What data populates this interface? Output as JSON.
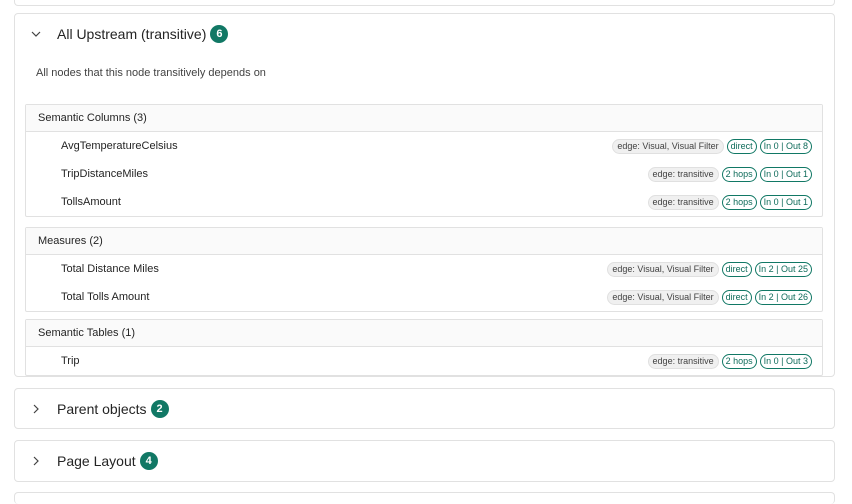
{
  "upstream": {
    "title": "All Upstream (transitive)",
    "count": "6",
    "description": "All nodes that this node transitively depends on",
    "groups": [
      {
        "label": "Semantic Columns (3)",
        "items": [
          {
            "name": "AvgTemperatureCelsius",
            "edge": "edge: Visual, Visual Filter",
            "distance": "direct",
            "io": "In 0 | Out 8"
          },
          {
            "name": "TripDistanceMiles",
            "edge": "edge: transitive",
            "distance": "2 hops",
            "io": "In 0 | Out 1"
          },
          {
            "name": "TollsAmount",
            "edge": "edge: transitive",
            "distance": "2 hops",
            "io": "In 0 | Out 1"
          }
        ]
      },
      {
        "label": "Measures (2)",
        "items": [
          {
            "name": "Total Distance Miles",
            "edge": "edge: Visual, Visual Filter",
            "distance": "direct",
            "io": "In 2 | Out 25"
          },
          {
            "name": "Total Tolls Amount",
            "edge": "edge: Visual, Visual Filter",
            "distance": "direct",
            "io": "In 2 | Out 26"
          }
        ]
      },
      {
        "label": "Semantic Tables (1)",
        "items": [
          {
            "name": "Trip",
            "edge": "edge: transitive",
            "distance": "2 hops",
            "io": "In 0 | Out 3"
          }
        ]
      }
    ]
  },
  "parent_objects": {
    "title": "Parent objects",
    "count": "2"
  },
  "page_layout": {
    "title": "Page Layout",
    "count": "4"
  },
  "colors": {
    "accent": "#117865",
    "border": "#e1e1e1"
  },
  "icons": {
    "expanded": "chevron-down-icon",
    "collapsed": "chevron-right-icon"
  }
}
